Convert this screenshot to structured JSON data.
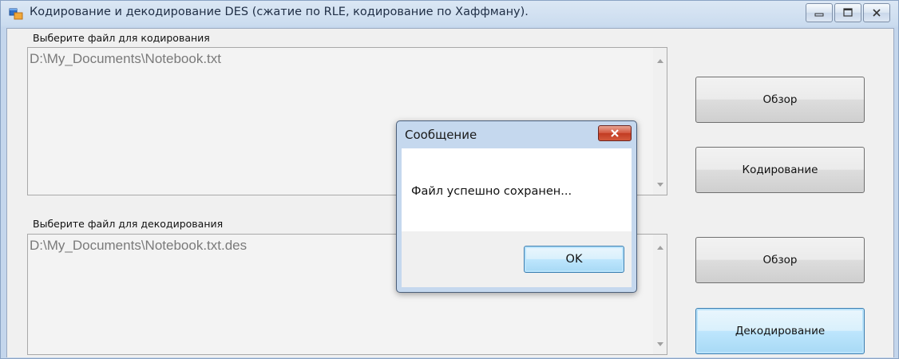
{
  "window": {
    "title": "Кодирование и декодирование DES (сжатие по RLE, кодирование по Хаффману).",
    "icon": "app-window-icon"
  },
  "encode_section": {
    "label": "Выберите файл для кодирования",
    "file_path": "D:\\My_Documents\\Notebook.txt",
    "browse_label": "Обзор",
    "action_label": "Кодирование"
  },
  "decode_section": {
    "label": "Выберите файл для декодирования",
    "file_path": "D:\\My_Documents\\Notebook.txt.des",
    "browse_label": "Обзор",
    "action_label": "Декодирование"
  },
  "message_box": {
    "title": "Сообщение",
    "message": "Файл успешно сохранен...",
    "ok_label": "OK"
  },
  "colors": {
    "close_button": "#c23b22",
    "focus_border": "#3c7fb1"
  }
}
